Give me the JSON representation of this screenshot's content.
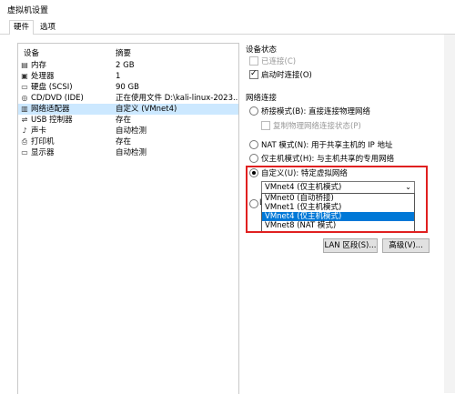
{
  "window": {
    "title": "虚拟机设置"
  },
  "tabs": [
    {
      "label": "硬件"
    },
    {
      "label": "选项"
    }
  ],
  "device_list": {
    "header_device": "设备",
    "header_summary": "摘要",
    "rows": [
      {
        "icon": "memory-icon",
        "name": "内存",
        "summary": "2 GB"
      },
      {
        "icon": "cpu-icon",
        "name": "处理器",
        "summary": "1"
      },
      {
        "icon": "disk-icon",
        "name": "硬盘 (SCSI)",
        "summary": "90 GB"
      },
      {
        "icon": "cd-icon",
        "name": "CD/DVD (IDE)",
        "summary": "正在使用文件 D:\\kali-linux-2023..."
      },
      {
        "icon": "network-icon",
        "name": "网络适配器",
        "summary": "自定义 (VMnet4)"
      },
      {
        "icon": "usb-icon",
        "name": "USB 控制器",
        "summary": "存在"
      },
      {
        "icon": "sound-icon",
        "name": "声卡",
        "summary": "自动检测"
      },
      {
        "icon": "printer-icon",
        "name": "打印机",
        "summary": "存在"
      },
      {
        "icon": "display-icon",
        "name": "显示器",
        "summary": "自动检测"
      }
    ]
  },
  "device_status": {
    "label": "设备状态",
    "connected": "已连接(C)",
    "connect_on_power": "启动时连接(O)"
  },
  "network": {
    "label": "网络连接",
    "bridged": "桥接模式(B): 直接连接物理网络",
    "replicate": "复制物理网络连接状态(P)",
    "nat": "NAT 模式(N): 用于共享主机的 IP 地址",
    "host_only": "仅主机模式(H): 与主机共享的专用网络",
    "custom": "自定义(U): 特定虚拟网络",
    "lan_partial": "L",
    "select_value": "VMnet4 (仅主机模式)",
    "options": [
      "VMnet0 (自动桥接)",
      "VMnet1 (仅主机模式)",
      "VMnet4 (仅主机模式)",
      "VMnet8 (NAT 模式)"
    ]
  },
  "buttons": {
    "lan_segments": "LAN 区段(S)...",
    "advanced": "高级(V)..."
  }
}
